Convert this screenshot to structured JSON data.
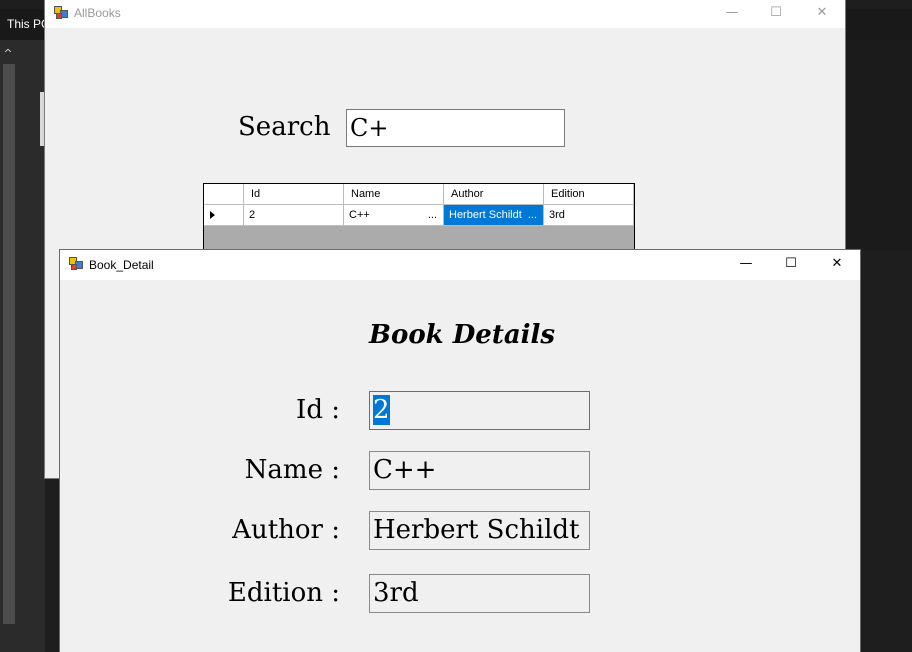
{
  "background_window": {
    "title": "This PC"
  },
  "allbooks": {
    "title": "AllBooks",
    "search_label": "Search",
    "search_value": "C+",
    "grid": {
      "columns": [
        "Id",
        "Name",
        "Author",
        "Edition"
      ],
      "rows": [
        {
          "id": "2",
          "name": "C++",
          "author": "Herbert Schildt",
          "edition": "3rd"
        }
      ],
      "ellipsis": "..."
    }
  },
  "book_detail": {
    "title": "Book_Detail",
    "heading": "Book Details",
    "fields": {
      "id": {
        "label": "Id :",
        "value": "2"
      },
      "name": {
        "label": "Name :",
        "value": "C++"
      },
      "author": {
        "label": "Author :",
        "value": "Herbert Schildt"
      },
      "edition": {
        "label": "Edition :",
        "value": "3rd"
      }
    }
  },
  "window_controls": {
    "minimize": "—",
    "maximize": "☐",
    "close": "✕"
  },
  "colors": {
    "selection": "#0078d7",
    "window_bg": "#f0f0f0",
    "desktop_bg": "#1e1e1e"
  }
}
